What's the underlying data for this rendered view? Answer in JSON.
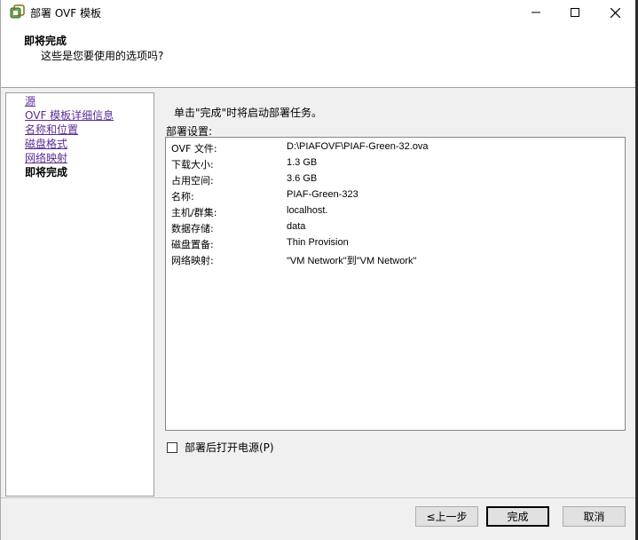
{
  "window": {
    "title": "部署 OVF 模板"
  },
  "header": {
    "title": "即将完成",
    "subtitle": "这些是您要使用的选项吗?"
  },
  "nav": {
    "items": [
      {
        "label": "源",
        "current": false
      },
      {
        "label": "OVF 模板详细信息",
        "current": false
      },
      {
        "label": "名称和位置",
        "current": false
      },
      {
        "label": "磁盘格式",
        "current": false
      },
      {
        "label": "网络映射",
        "current": false
      },
      {
        "label": "即将完成",
        "current": true
      }
    ]
  },
  "main": {
    "hint": "单击\"完成\"时将启动部署任务。",
    "settings_label": "部署设置:",
    "settings": [
      {
        "key": "OVF 文件:",
        "value": "D:\\PIAFOVF\\PIAF-Green-32.ova"
      },
      {
        "key": "下载大小:",
        "value": "1.3 GB"
      },
      {
        "key": "占用空间:",
        "value": "3.6 GB"
      },
      {
        "key": "名称:",
        "value": "PIAF-Green-323"
      },
      {
        "key": "主机/群集:",
        "value": "localhost."
      },
      {
        "key": "数据存储:",
        "value": "data"
      },
      {
        "key": "磁盘置备:",
        "value": "Thin Provision"
      },
      {
        "key": "网络映射:",
        "value": "\"VM Network\"到\"VM Network\""
      }
    ],
    "power_on_label": "部署后打开电源(P)",
    "power_on_checked": false
  },
  "footer": {
    "back_label": "≤上一步",
    "finish_label": "完成",
    "cancel_label": "取消"
  },
  "colors": {
    "link": "#5a2d91",
    "window_bg": "#f0f0f0",
    "panel_bg": "#ffffff"
  }
}
